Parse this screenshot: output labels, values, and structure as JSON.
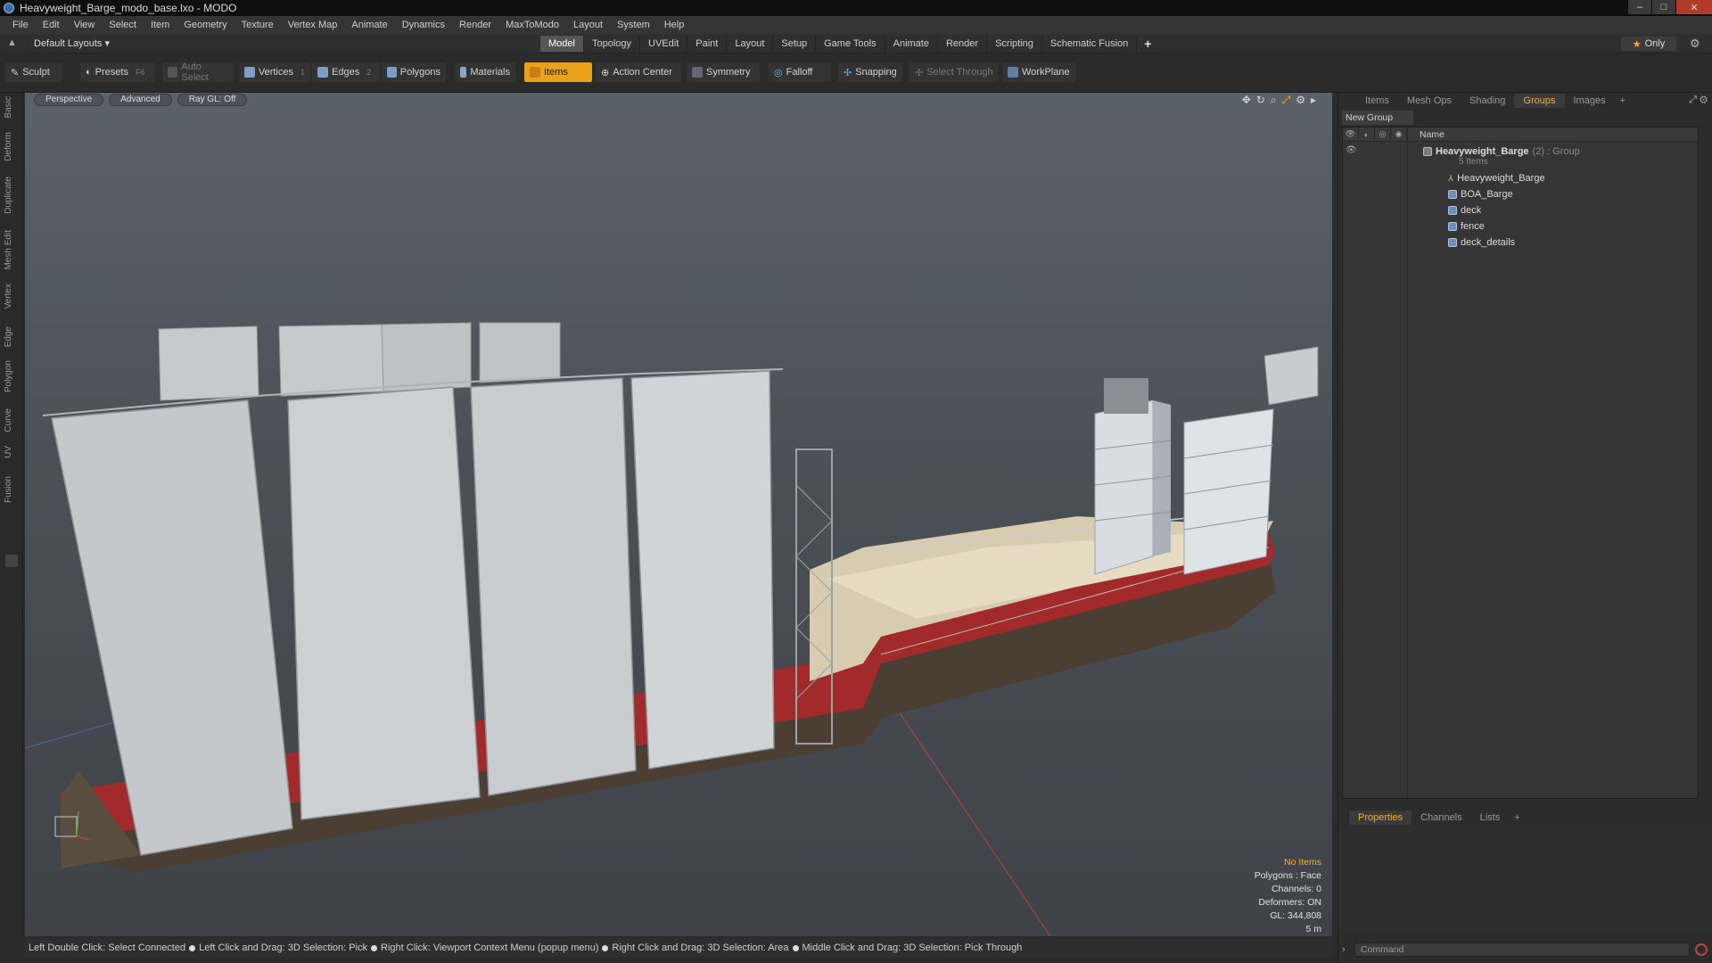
{
  "window": {
    "title": "Heavyweight_Barge_modo_base.lxo - MODO",
    "controls": [
      "–",
      "□",
      "✕"
    ]
  },
  "menu": [
    "File",
    "Edit",
    "View",
    "Select",
    "Item",
    "Geometry",
    "Texture",
    "Vertex Map",
    "Animate",
    "Dynamics",
    "Render",
    "MaxToModo",
    "Layout",
    "System",
    "Help"
  ],
  "layout_row": {
    "layouts_label": "Default Layouts ▾",
    "tabs": [
      "Model",
      "Topology",
      "UVEdit",
      "Paint",
      "Layout",
      "Setup",
      "Game Tools",
      "Animate",
      "Render",
      "Scripting",
      "Schematic Fusion"
    ],
    "active_tab": "Model",
    "add_tab": "+",
    "only_label": "Only",
    "only_star": "★"
  },
  "toolbar": {
    "sculpt": "Sculpt",
    "presets": "Presets",
    "presets_key": "F6",
    "auto_select": "Auto Select",
    "vertices": "Vertices",
    "vertices_key": "1",
    "edges": "Edges",
    "edges_key": "2",
    "polygons": "Polygons",
    "materials": "Materials",
    "items": "Items",
    "action_center": "Action Center",
    "symmetry": "Symmetry",
    "falloff": "Falloff",
    "snapping": "Snapping",
    "select_through": "Select Through",
    "workplane": "WorkPlane"
  },
  "left_tabs": [
    "Basic",
    "Deform",
    "Duplicate",
    "Mesh Edit",
    "Vertex",
    "Edge",
    "Polygon",
    "Curve",
    "UV",
    "Fusion"
  ],
  "viewport": {
    "chips": [
      "Perspective",
      "Advanced",
      "Ray GL: Off"
    ],
    "info": {
      "selection": "No Items",
      "polygons": "Polygons : Face",
      "channels": "Channels: 0",
      "deformers": "Deformers: ON",
      "gl": "GL: 344,808",
      "scale": "5 m"
    }
  },
  "statusbar": {
    "hints": [
      "Left Double Click: Select Connected",
      "Left Click and Drag: 3D Selection: Pick",
      "Right Click: Viewport Context Menu (popup menu)",
      "Right Click and Drag: 3D Selection: Area",
      "Middle Click and Drag: 3D Selection: Pick Through"
    ]
  },
  "right_panel": {
    "tabs": [
      "Items",
      "Mesh Ops",
      "Shading",
      "Groups",
      "Images"
    ],
    "active_tab": "Groups",
    "add_tab": "+",
    "new_group": "New Group",
    "name_header": "Name",
    "group": {
      "name": "Heavyweight_Barge",
      "info": "(2) : Group",
      "count": "5 Items"
    },
    "children": [
      {
        "name": "Heavyweight_Barge",
        "icon": "locator-icon"
      },
      {
        "name": "BOA_Barge",
        "icon": "mesh-icon"
      },
      {
        "name": "deck",
        "icon": "mesh-icon"
      },
      {
        "name": "fence",
        "icon": "mesh-icon"
      },
      {
        "name": "deck_details",
        "icon": "mesh-icon"
      }
    ],
    "bottom_tabs": [
      "Properties",
      "Channels",
      "Lists"
    ],
    "bottom_active": "Properties",
    "command_placeholder": "Command"
  },
  "colors": {
    "accent": "#f0b030",
    "hull_red": "#a22a2a",
    "deck": "#d8ccb0"
  }
}
